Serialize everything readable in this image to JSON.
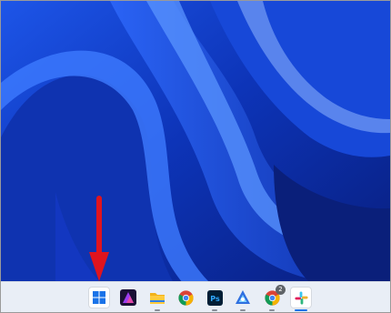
{
  "desktop": {
    "wallpaper": "windows-11-bloom-wallpaper",
    "accent_colors": {
      "deep": "#0a1f7a",
      "mid": "#1746d6",
      "light": "#3d7bff",
      "highlight": "#8fb6ff"
    }
  },
  "annotation": {
    "arrow_color": "#e0141e",
    "points_to": "start-button"
  },
  "taskbar": {
    "background": "#e9eef6",
    "items": [
      {
        "name": "start-button",
        "icon": "windows-logo-icon",
        "active": true
      },
      {
        "name": "taskbar-app-2",
        "icon": "purple-app-icon"
      },
      {
        "name": "file-explorer",
        "icon": "folder-icon",
        "running": true
      },
      {
        "name": "chrome",
        "icon": "chrome-icon"
      },
      {
        "name": "photoshop",
        "icon": "photoshop-icon",
        "label": "Ps",
        "running": true
      },
      {
        "name": "taskbar-app-6",
        "icon": "triangle-app-icon",
        "running": true
      },
      {
        "name": "chrome-profile",
        "icon": "chrome-profile-icon",
        "badge": "2",
        "running": true
      },
      {
        "name": "slack",
        "icon": "slack-icon",
        "active": true,
        "running": true
      }
    ]
  }
}
